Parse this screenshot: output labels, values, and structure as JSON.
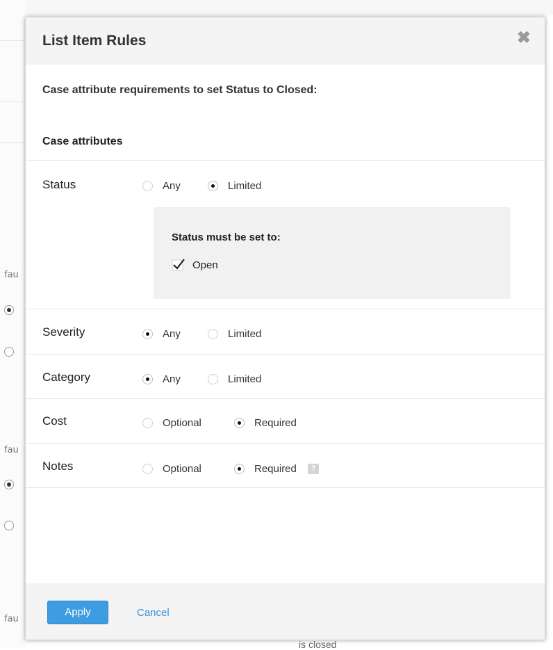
{
  "background": {
    "left_labels": [
      "fau",
      "fau",
      "fau"
    ],
    "bottom_text": "is closed"
  },
  "dialog": {
    "title": "List Item Rules",
    "close_glyph": "✖",
    "intro": "Case attribute requirements to set Status to Closed:",
    "section_heading": "Case attributes",
    "rows": [
      {
        "label": "Status",
        "options": [
          {
            "label": "Any",
            "selected": false
          },
          {
            "label": "Limited",
            "selected": true
          }
        ],
        "subpanel": {
          "title": "Status must be set to:",
          "checks": [
            {
              "label": "Open",
              "checked": true
            }
          ]
        }
      },
      {
        "label": "Severity",
        "options": [
          {
            "label": "Any",
            "selected": true
          },
          {
            "label": "Limited",
            "selected": false
          }
        ]
      },
      {
        "label": "Category",
        "options": [
          {
            "label": "Any",
            "selected": true
          },
          {
            "label": "Limited",
            "selected": false
          }
        ]
      },
      {
        "label": "Cost",
        "options": [
          {
            "label": "Optional",
            "selected": false
          },
          {
            "label": "Required",
            "selected": true
          }
        ]
      },
      {
        "label": "Notes",
        "options": [
          {
            "label": "Optional",
            "selected": false
          },
          {
            "label": "Required",
            "selected": true
          }
        ],
        "help_icon": "help-icon"
      }
    ],
    "footer": {
      "apply_label": "Apply",
      "cancel_label": "Cancel"
    }
  },
  "colors": {
    "primary_button": "#3d9de0",
    "link": "#3a8fd6",
    "header_bg": "#f4f4f4"
  }
}
